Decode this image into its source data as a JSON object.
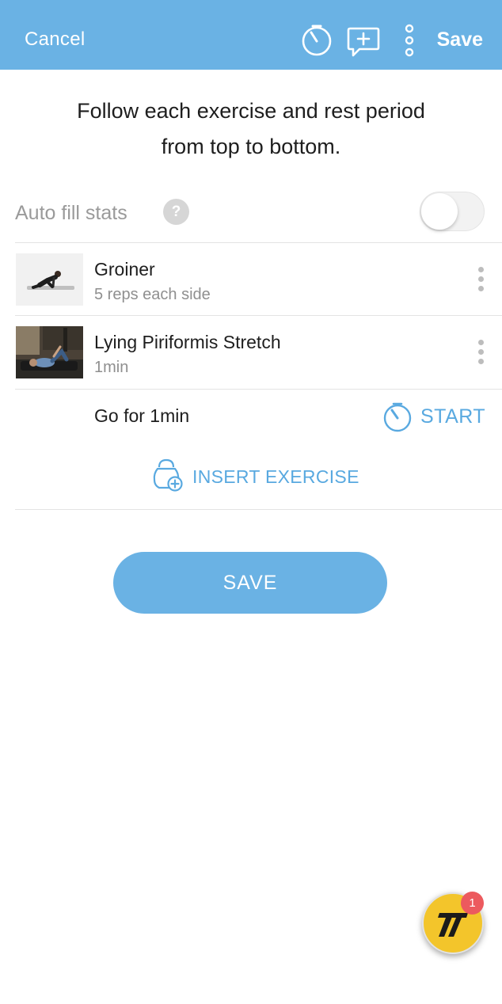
{
  "header": {
    "cancel_label": "Cancel",
    "save_label": "Save",
    "background_color": "#6ab2e4",
    "icons": [
      "stopwatch-icon",
      "add-comment-icon",
      "more-vertical-icon"
    ]
  },
  "instructions": {
    "line1": "Follow each exercise and rest period",
    "line2": "from top to bottom."
  },
  "auto_fill": {
    "label": "Auto fill stats",
    "help_symbol": "?",
    "enabled": false
  },
  "exercises": [
    {
      "name": "Groiner",
      "detail": "5 reps each side"
    },
    {
      "name": "Lying Piriformis Stretch",
      "detail": "1min"
    }
  ],
  "rest": {
    "text": "Go for 1min",
    "start_label": "START"
  },
  "insert_label": "INSERT EXERCISE",
  "save_button_label": "SAVE",
  "accent_color": "#59a9e0",
  "fab": {
    "badge_count": "1",
    "color": "#f3c52b"
  }
}
